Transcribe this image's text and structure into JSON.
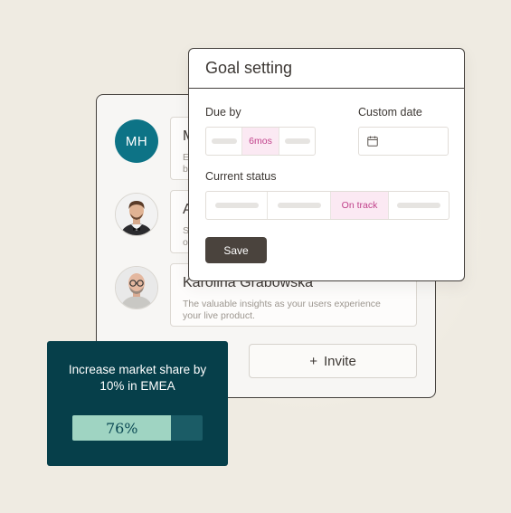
{
  "team": {
    "members": [
      {
        "initials": "MH",
        "name": "M",
        "desc_lines": [
          "E",
          "b"
        ],
        "avatar": "initials-avatar"
      },
      {
        "initials": "",
        "name": "A",
        "desc_lines": [
          "S",
          "o"
        ],
        "avatar": "man-bowtie-photo"
      },
      {
        "initials": "",
        "name": "Karolina Grabowska",
        "desc_lines": [
          "The valuable insights as your users experience",
          "your live product."
        ],
        "avatar": "man-glasses-photo"
      }
    ],
    "invite": {
      "icon": "plus-icon",
      "label": "Invite",
      "plus": "+"
    }
  },
  "goal_setting": {
    "title": "Goal setting",
    "due_by": {
      "label": "Due by",
      "selected": "6mos"
    },
    "custom_date": {
      "label": "Custom date",
      "icon": "calendar-icon"
    },
    "current_status": {
      "label": "Current status",
      "selected": "On track"
    },
    "save_label": "Save"
  },
  "goal_card": {
    "text": "Increase market share by 10% in EMEA",
    "progress_percent": 76,
    "progress_label": "76%"
  },
  "colors": {
    "accent_teal": "#063f4a",
    "progress_fill": "#9fd4c2",
    "initials_avatar": "#0d7386",
    "selected_pill_bg": "#fbe9f3",
    "selected_pill_text": "#c0408a",
    "save_button": "#4a433d"
  }
}
